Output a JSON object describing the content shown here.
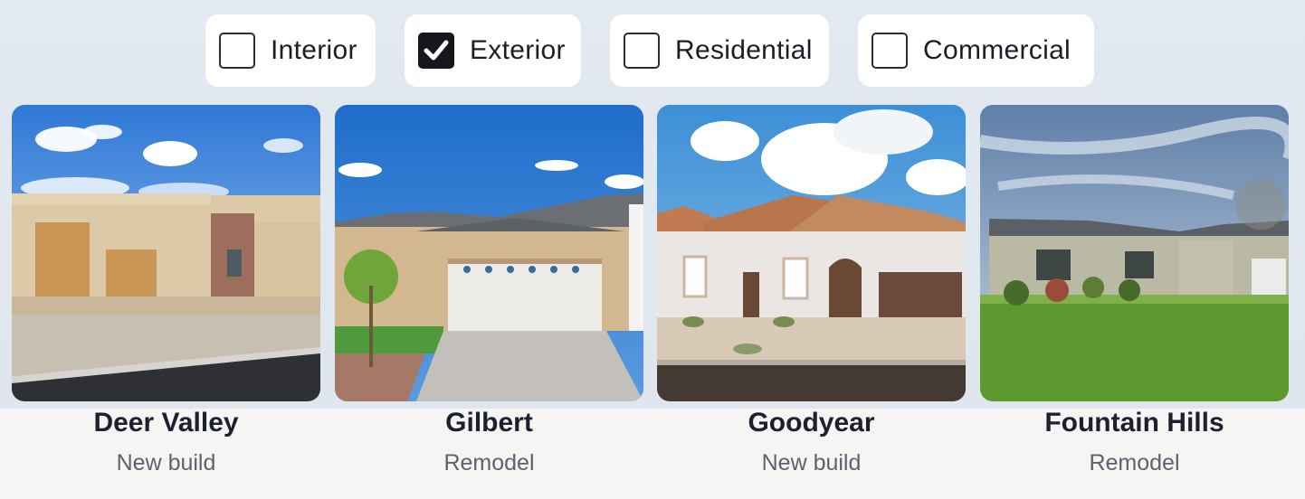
{
  "filters": [
    {
      "label": "Interior",
      "checked": false
    },
    {
      "label": "Exterior",
      "checked": true
    },
    {
      "label": "Residential",
      "checked": false
    },
    {
      "label": "Commercial",
      "checked": false
    }
  ],
  "projects": [
    {
      "title": "Deer Valley",
      "subtitle": "New build"
    },
    {
      "title": "Gilbert",
      "subtitle": "Remodel"
    },
    {
      "title": "Goodyear",
      "subtitle": "New build"
    },
    {
      "title": "Fountain Hills",
      "subtitle": "Remodel"
    }
  ],
  "icons": {
    "checkmark": "checkmark-icon"
  }
}
